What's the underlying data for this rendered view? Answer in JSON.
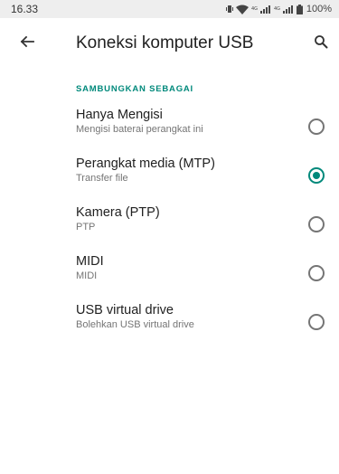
{
  "status_bar": {
    "time": "16.33",
    "battery": "100%",
    "icons": [
      "vibrate-icon",
      "wifi-icon",
      "signal-4g-icon",
      "signal-4g-icon",
      "battery-icon"
    ]
  },
  "header": {
    "title": "Koneksi komputer USB",
    "back_icon": "arrow-back-icon",
    "search_icon": "search-icon"
  },
  "section": {
    "label": "SAMBUNGKAN SEBAGAI"
  },
  "options": [
    {
      "title": "Hanya Mengisi",
      "subtitle": "Mengisi baterai perangkat ini",
      "selected": false
    },
    {
      "title": "Perangkat media (MTP)",
      "subtitle": "Transfer file",
      "selected": true
    },
    {
      "title": "Kamera (PTP)",
      "subtitle": "PTP",
      "selected": false
    },
    {
      "title": "MIDI",
      "subtitle": "MIDI",
      "selected": false
    },
    {
      "title": "USB virtual drive",
      "subtitle": "Bolehkan USB virtual drive",
      "selected": false
    }
  ],
  "colors": {
    "accent": "#00897b",
    "status_bar_bg": "#eeeeee",
    "radio_unchecked": "#757575"
  }
}
